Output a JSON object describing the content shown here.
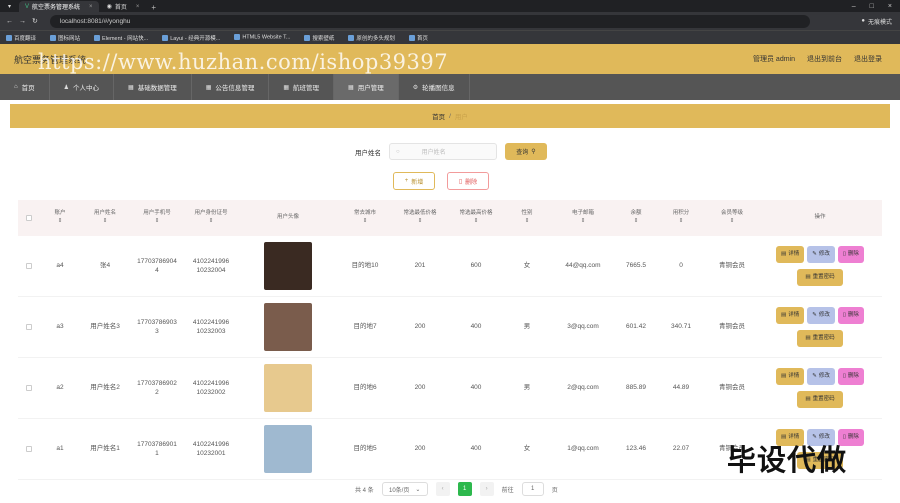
{
  "browser": {
    "tabs": [
      {
        "label": "航空票务管理系统",
        "active": true
      },
      {
        "label": "首页",
        "active": false
      }
    ],
    "url": "localhost:8081/#/yonghu",
    "account": "无痕模式",
    "bookmarks": [
      "百度翻译",
      "图标网站",
      "Element - 网站快...",
      "Layui - 经典开源模...",
      "HTML5 Website T...",
      "搜索壁纸",
      "原创的多头规划",
      "首页"
    ]
  },
  "app": {
    "title": "航空票务管理系统",
    "watermark": "https://www.huzhan.com/ishop39397",
    "header_links": [
      "管理员 admin",
      "退出到前台",
      "退出登录"
    ]
  },
  "nav": [
    {
      "label": "首页",
      "icon": "home-icon"
    },
    {
      "label": "个人中心",
      "icon": "user-icon"
    },
    {
      "label": "基础数据管理",
      "icon": "table-icon"
    },
    {
      "label": "公告信息管理",
      "icon": "table-icon"
    },
    {
      "label": "航班管理",
      "icon": "table-icon"
    },
    {
      "label": "用户管理",
      "icon": "table-icon",
      "active": true
    },
    {
      "label": "轮播图信息",
      "icon": "gear-icon"
    }
  ],
  "breadcrumb": {
    "home": "首页",
    "sep": "/",
    "current": "用户"
  },
  "search": {
    "label": "用户姓名",
    "placeholder": "用户姓名",
    "button": "查询"
  },
  "toolbar": {
    "add": "新增",
    "delete": "删除"
  },
  "table": {
    "columns": [
      "账户",
      "用户姓名",
      "用户手机号",
      "用户身份证号",
      "用户头像",
      "常去城市",
      "常选最低价格",
      "常选最高价格",
      "性别",
      "电子邮箱",
      "余额",
      "用积分",
      "会员等级",
      "操作"
    ],
    "rows": [
      {
        "account": "a4",
        "name": "张4",
        "phone1": "17703786904",
        "phone2": "4",
        "id1": "4102241996",
        "id2": "10232004",
        "city": "目的地10",
        "min": "201",
        "max": "600",
        "sex": "女",
        "email": "44@qq.com",
        "balance": "7665.5",
        "points": "0",
        "level": "青铜会员",
        "avatar_color": "#3a2a22"
      },
      {
        "account": "a3",
        "name": "用户姓名3",
        "phone1": "17703786903",
        "phone2": "3",
        "id1": "4102241996",
        "id2": "10232003",
        "city": "目的地7",
        "min": "200",
        "max": "400",
        "sex": "男",
        "email": "3@qq.com",
        "balance": "601.42",
        "points": "340.71",
        "level": "青铜会员",
        "avatar_color": "#7a5c4c"
      },
      {
        "account": "a2",
        "name": "用户姓名2",
        "phone1": "17703786902",
        "phone2": "2",
        "id1": "4102241996",
        "id2": "10232002",
        "city": "目的地6",
        "min": "200",
        "max": "400",
        "sex": "男",
        "email": "2@qq.com",
        "balance": "885.89",
        "points": "44.89",
        "level": "青铜会员",
        "avatar_color": "#e7c98e"
      },
      {
        "account": "a1",
        "name": "用户姓名1",
        "phone1": "17703786901",
        "phone2": "1",
        "id1": "4102241996",
        "id2": "10232001",
        "city": "目的地5",
        "min": "200",
        "max": "400",
        "sex": "女",
        "email": "1@qq.com",
        "balance": "123.46",
        "points": "22.07",
        "level": "青铜会员",
        "avatar_color": "#9fb9d0"
      }
    ],
    "op_labels": {
      "detail": "详情",
      "edit": "修改",
      "delete": "删除",
      "reset": "重置密码"
    }
  },
  "pager": {
    "total": "共 4 条",
    "size": "10条/页",
    "page": "1",
    "goto": "前往",
    "goto_value": "1",
    "unit": "页"
  },
  "overlay_text": "毕设代做"
}
